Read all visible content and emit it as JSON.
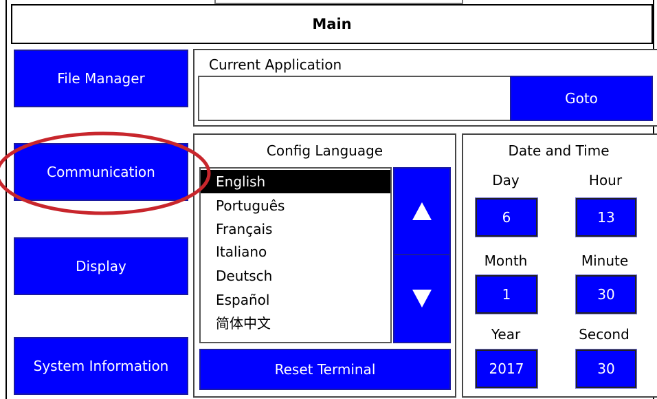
{
  "header": {
    "title": "Main"
  },
  "sidebar": {
    "items": [
      {
        "label": "File Manager"
      },
      {
        "label": "Communication"
      },
      {
        "label": "Display"
      },
      {
        "label": "System Information"
      }
    ]
  },
  "current_application": {
    "label": "Current Application",
    "value": "",
    "goto_label": "Goto"
  },
  "config_language": {
    "title": "Config Language",
    "items": [
      "English",
      "Português",
      "Français",
      "Italiano",
      "Deutsch",
      "Español",
      "简体中文"
    ],
    "selected": "English",
    "up_icon": "up-triangle-icon",
    "down_icon": "down-triangle-icon",
    "reset_label": "Reset Terminal"
  },
  "date_time": {
    "title": "Date and Time",
    "day_label": "Day",
    "day": "6",
    "hour_label": "Hour",
    "hour": "13",
    "month_label": "Month",
    "month": "1",
    "minute_label": "Minute",
    "minute": "30",
    "year_label": "Year",
    "year": "2017",
    "second_label": "Second",
    "second": "30"
  },
  "annotation": {
    "color": "#c8262c"
  },
  "colors": {
    "button_blue": "#0000ff",
    "selection": "#000000"
  }
}
